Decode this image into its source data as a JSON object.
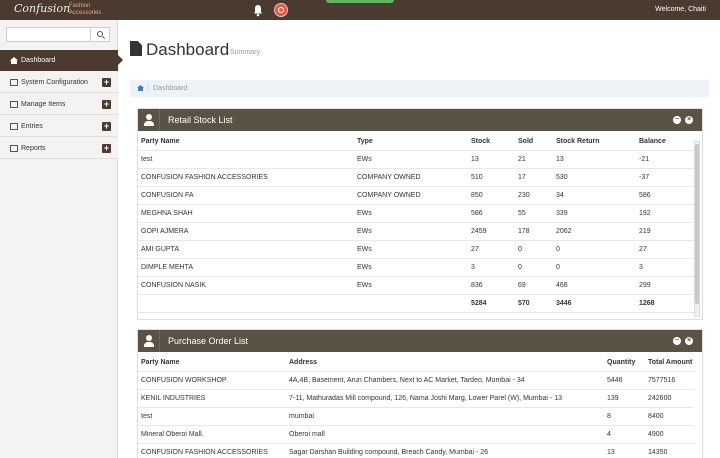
{
  "header": {
    "logo": "Confusion",
    "tagline_line1": "Fashion",
    "tagline_line2": "Accessories",
    "welcome": "Welcome, Chaiti",
    "icons": [
      "bell-icon",
      "help-icon"
    ]
  },
  "sidebar": {
    "search_placeholder": "",
    "items": [
      {
        "label": "Dashboard",
        "icon": "home-icon",
        "active": true,
        "expandable": false
      },
      {
        "label": "System Configuration",
        "icon": "server-icon",
        "active": false,
        "expandable": true
      },
      {
        "label": "Manage Items",
        "icon": "table-icon",
        "active": false,
        "expandable": true
      },
      {
        "label": "Entries",
        "icon": "list-icon",
        "active": false,
        "expandable": true
      },
      {
        "label": "Reports",
        "icon": "report-icon",
        "active": false,
        "expandable": true
      }
    ],
    "expand_symbol": "+"
  },
  "main": {
    "title": "Dashboard",
    "subtitle": "Summary",
    "breadcrumb": "Dashboard"
  },
  "retail": {
    "title": "Retail Stock List",
    "columns": [
      "Party Name",
      "Type",
      "Stock",
      "Sold",
      "Stock Return",
      "Balance"
    ],
    "rows": [
      [
        "test",
        "EWs",
        "13",
        "21",
        "13",
        "-21"
      ],
      [
        "CONFUSION FASHION ACCESSORIES",
        "COMPANY OWNED",
        "510",
        "17",
        "530",
        "-37"
      ],
      [
        "CONFUSION FA",
        "COMPANY OWNED",
        "850",
        "230",
        "34",
        "586"
      ],
      [
        "MEGHNA SHAH",
        "EWs",
        "586",
        "55",
        "339",
        "192"
      ],
      [
        "GOPI AJMERA",
        "EWs",
        "2459",
        "178",
        "2062",
        "219"
      ],
      [
        "AMI GUPTA",
        "EWs",
        "27",
        "0",
        "0",
        "27"
      ],
      [
        "DIMPLE MEHTA",
        "EWs",
        "3",
        "0",
        "0",
        "3"
      ],
      [
        "CONFUSION NASIK",
        "EWs",
        "836",
        "69",
        "468",
        "299"
      ]
    ],
    "totals": [
      "",
      "",
      "5284",
      "570",
      "3446",
      "1268"
    ]
  },
  "purchase": {
    "title": "Purchase Order List",
    "columns": [
      "Party Name",
      "Address",
      "Quantity",
      "Total Amount"
    ],
    "rows": [
      [
        "CONFUSION WORKSHOP",
        "4A,4B, Basement, Arun Chambers, Next to AC Market, Tardeo, Mumbai - 34",
        "5446",
        "7577516"
      ],
      [
        "KENIL INDUSTRIES",
        "7-11, Mathuradas Mill compound, 126, Nama Joshi Marg, Lower Parel (W), Mumbai - 13",
        "139",
        "242600"
      ],
      [
        "test",
        "mumbai",
        "8",
        "8400"
      ],
      [
        "Mineral Oberoi Mall.",
        "Oberoi mall",
        "4",
        "4900"
      ],
      [
        "CONFUSION FASHION ACCESSORIES",
        "Sagar Darshan Building compound, Breach Candy, Mumbai - 26",
        "13",
        "14350"
      ]
    ]
  },
  "panel_controls": {
    "collapse": "−",
    "close": "×"
  },
  "colors": {
    "brand": "#4a3a30",
    "panel_header": "#5a5244",
    "accent": "#5cb85c",
    "help": "#e25a4a"
  }
}
